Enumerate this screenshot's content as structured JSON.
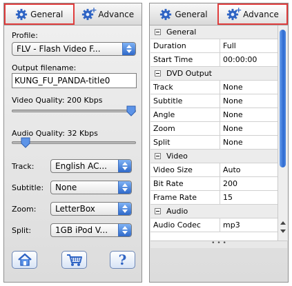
{
  "left_panel": {
    "tabs": [
      {
        "label": "General",
        "icon": "gear-icon",
        "active": true
      },
      {
        "label": "Advance",
        "icon": "gear-plus-icon",
        "active": false
      }
    ],
    "profile": {
      "label": "Profile:",
      "value": "FLV - Flash Video F..."
    },
    "output_filename": {
      "label": "Output filename:",
      "value": "KUNG_FU_PANDA-title0"
    },
    "video_quality": {
      "label": "Video Quality:  200 Kbps",
      "level": 1.0
    },
    "audio_quality": {
      "label": "Audio Quality:  32 Kbps",
      "level": 0.08
    },
    "track": {
      "label": "Track:",
      "value": "English AC..."
    },
    "subtitle": {
      "label": "Subtitle:",
      "value": "None"
    },
    "zoom": {
      "label": "Zoom:",
      "value": "LetterBox"
    },
    "split": {
      "label": "Split:",
      "value": "1GB iPod V..."
    },
    "buttons": [
      {
        "name": "home-button",
        "icon": "home-icon"
      },
      {
        "name": "cart-button",
        "icon": "cart-icon"
      },
      {
        "name": "help-button",
        "icon": "help-icon",
        "glyph": "?"
      }
    ]
  },
  "right_panel": {
    "tabs": [
      {
        "label": "General",
        "icon": "gear-icon",
        "active": false
      },
      {
        "label": "Advance",
        "icon": "gear-plus-icon",
        "active": true
      }
    ],
    "sections": [
      {
        "title": "General",
        "rows": [
          {
            "key": "Duration",
            "value": "Full"
          },
          {
            "key": "Start Time",
            "value": "00:00:00"
          }
        ]
      },
      {
        "title": "DVD Output",
        "rows": [
          {
            "key": "Track",
            "value": "None"
          },
          {
            "key": "Subtitle",
            "value": "None"
          },
          {
            "key": "Angle",
            "value": "None"
          },
          {
            "key": "Zoom",
            "value": "None"
          },
          {
            "key": "Split",
            "value": "None"
          }
        ]
      },
      {
        "title": "Video",
        "rows": [
          {
            "key": "Video Size",
            "value": "Auto"
          },
          {
            "key": "Bit Rate",
            "value": "200"
          },
          {
            "key": "Frame Rate",
            "value": "15"
          }
        ]
      },
      {
        "title": "Audio",
        "rows": [
          {
            "key": "Audio Codec",
            "value": "mp3"
          }
        ]
      }
    ],
    "resize_grip": "• • •"
  },
  "colors": {
    "active_tab_border": "#e03c3c",
    "accent_blue": "#2f69c9"
  }
}
